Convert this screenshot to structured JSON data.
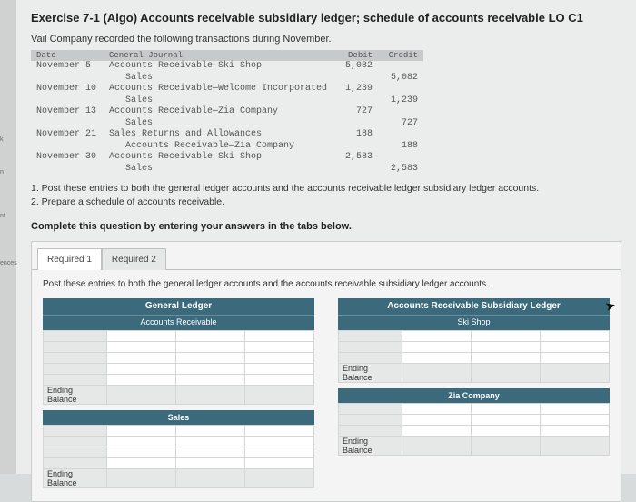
{
  "left_labels": {
    "a": "k",
    "b": "n",
    "c": "nt",
    "d": "ences"
  },
  "title": "Exercise 7-1 (Algo) Accounts receivable subsidiary ledger; schedule of accounts receivable LO C1",
  "intro": "Vail Company recorded the following transactions during November.",
  "journal": {
    "headers": {
      "date": "Date",
      "desc": "General Journal",
      "debit": "Debit",
      "credit": "Credit"
    },
    "rows": [
      {
        "date": "November 5",
        "desc": "Accounts Receivable—Ski Shop",
        "debit": "5,082",
        "credit": ""
      },
      {
        "date": "",
        "desc": "Sales",
        "debit": "",
        "credit": "5,082",
        "indent": true
      },
      {
        "date": "November 10",
        "desc": "Accounts Receivable—Welcome Incorporated",
        "debit": "1,239",
        "credit": ""
      },
      {
        "date": "",
        "desc": "Sales",
        "debit": "",
        "credit": "1,239",
        "indent": true
      },
      {
        "date": "November 13",
        "desc": "Accounts Receivable—Zia Company",
        "debit": "727",
        "credit": ""
      },
      {
        "date": "",
        "desc": "Sales",
        "debit": "",
        "credit": "727",
        "indent": true
      },
      {
        "date": "November 21",
        "desc": "Sales Returns and Allowances",
        "debit": "188",
        "credit": ""
      },
      {
        "date": "",
        "desc": "Accounts Receivable—Zia Company",
        "debit": "",
        "credit": "188",
        "indent": true
      },
      {
        "date": "November 30",
        "desc": "Accounts Receivable—Ski Shop",
        "debit": "2,583",
        "credit": ""
      },
      {
        "date": "",
        "desc": "Sales",
        "debit": "",
        "credit": "2,583",
        "indent": true
      }
    ]
  },
  "instructions": "1. Post these entries to both the general ledger accounts and the accounts receivable ledger subsidiary ledger accounts.\n2. Prepare a schedule of accounts receivable.",
  "tab_instr": "Complete this question by entering your answers in the tabs below.",
  "tabs": {
    "r1": "Required 1",
    "r2": "Required 2"
  },
  "subtext": "Post these entries to both the general ledger accounts and the accounts receivable subsidiary ledger accounts.",
  "ledger_left": {
    "header1": "General Ledger",
    "header2": "Accounts Receivable",
    "ending": "Ending Balance",
    "acct2": "Sales",
    "ending2": "Ending Balance"
  },
  "ledger_right": {
    "header1": "Accounts Receivable Subsidiary Ledger",
    "header2": "Ski Shop",
    "ending": "Ending Balance",
    "acct2": "Zia Company",
    "ending2": "Ending Balance"
  }
}
